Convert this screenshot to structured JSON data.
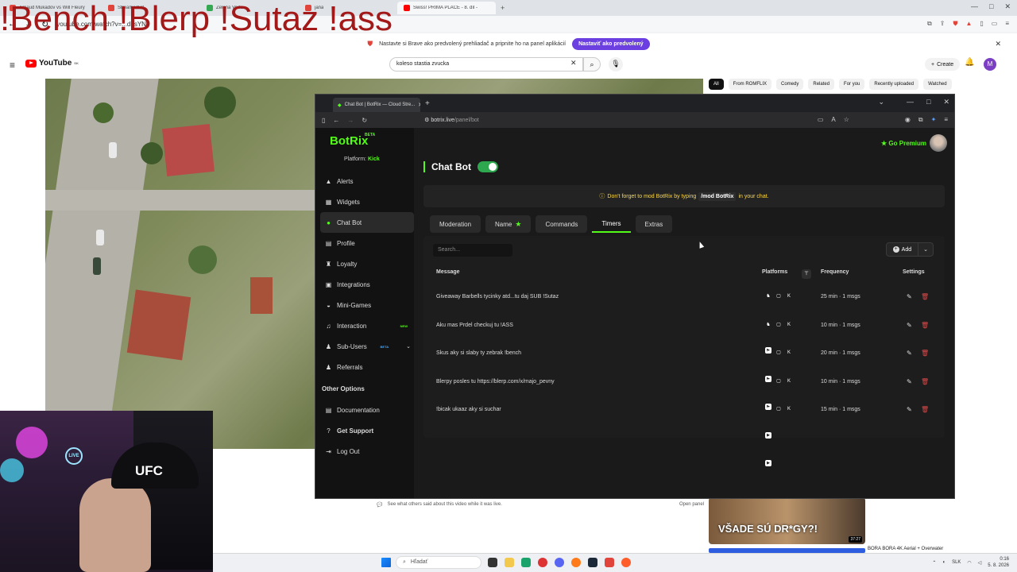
{
  "overlay_text": "!Bench !Blerp !Sutaz !ass",
  "outer_browser": {
    "tabs": [
      {
        "label": "Arnaud Mukadov vs Will Fleury",
        "color": "#e0443a"
      },
      {
        "label": "Streamerbot",
        "color": "#e0443a"
      },
      {
        "label": "Zelená Voda",
        "color": "#34a853"
      },
      {
        "label": "jana",
        "color": "#e0443a"
      },
      {
        "label": "Swiss! PRIMA PLACE - 8. díl -",
        "color": "#ff0000"
      }
    ],
    "url": "youtube.com/watch?v=...dbsYN",
    "banner_text": "Nastavte si Brave ako predvolený prehliadač a pripnite ho na panel aplikácií",
    "banner_button": "Nastaviť ako predvolený"
  },
  "youtube": {
    "logo": "YouTube",
    "logo_sup": "SK",
    "search_value": "koleso stastia zvucka",
    "create_label": "Create",
    "avatar_letter": "M",
    "chips": [
      "All",
      "From ROMFLIX",
      "Comedy",
      "Related",
      "For you",
      "Recently uploaded",
      "Watched"
    ],
    "live_chat_text": "See what others said about this video while it was live.",
    "live_chat_open": "Open panel",
    "related_caption": "VŠADE SÚ DR*GY?!",
    "related_duration": "37:27",
    "related_title": "BORA BORA 4K Aerial + Overwater"
  },
  "taskbar": {
    "search_placeholder": "Hľadať",
    "lang": "SLK",
    "time": "0:16",
    "date": "5. 8. 2026"
  },
  "webcam": {
    "cap_text": "UFC",
    "live_badge": "LIVE"
  },
  "inner_browser": {
    "tab_label": "Chat Bot | BotRix — Cloud Stre...",
    "url_host": "botrix.live",
    "url_path": "/panel/bot"
  },
  "botrix": {
    "brand": "BotRix",
    "brand_badge": "BETA",
    "platform_label": "Platform:",
    "platform_value": "Kick",
    "nav": [
      {
        "label": "Alerts",
        "icon": "triangle-alert-icon"
      },
      {
        "label": "Widgets",
        "icon": "widgets-icon"
      },
      {
        "label": "Chat Bot",
        "icon": "chat-bubble-icon",
        "active": true
      },
      {
        "label": "Profile",
        "icon": "profile-card-icon"
      },
      {
        "label": "Loyalty",
        "icon": "trophy-icon"
      },
      {
        "label": "Integrations",
        "icon": "plug-icon"
      },
      {
        "label": "Mini-Games",
        "icon": "gamepad-icon"
      },
      {
        "label": "Interaction",
        "icon": "music-note-icon",
        "badge": "NEW"
      },
      {
        "label": "Sub-Users",
        "icon": "users-icon",
        "badge": "BETA"
      },
      {
        "label": "Referrals",
        "icon": "referrals-icon"
      }
    ],
    "other_options_heading": "Other Options",
    "other_options": [
      {
        "label": "Documentation",
        "icon": "document-icon"
      },
      {
        "label": "Get Support",
        "icon": "help-circle-icon"
      },
      {
        "label": "Log Out",
        "icon": "logout-icon"
      }
    ],
    "premium_label": "Go Premium",
    "page_title": "Chat Bot",
    "toggle_on": true,
    "notice_pre": "Don't forget to mod BotRix by typing",
    "notice_code": "/mod BotRix",
    "notice_post": "in your chat.",
    "tabs": [
      "Moderation",
      "Name",
      "Commands",
      "Timers",
      "Extras"
    ],
    "active_tab": "Timers",
    "search_placeholder": "Search...",
    "add_label": "Add",
    "columns": {
      "message": "Message",
      "platforms": "Platforms",
      "frequency": "Frequency",
      "settings": "Settings"
    },
    "timers": [
      {
        "message": "Giveaway Barbells tycinky atd...tu daj SUB !Sutaz",
        "frequency": "25 min · 1 msgs"
      },
      {
        "message": "Aku mas Prdel checkuj tu !ASS",
        "frequency": "10 min · 1 msgs"
      },
      {
        "message": "Skus aky si slaby ty zebrak !bench",
        "frequency": "20 min · 1 msgs"
      },
      {
        "message": "Blerpy posles tu https://blerp.com/x/majo_pevny",
        "frequency": "10 min · 1 msgs"
      },
      {
        "message": "!bicak ukaaz aky si suchar",
        "frequency": "15 min · 1 msgs"
      }
    ]
  }
}
